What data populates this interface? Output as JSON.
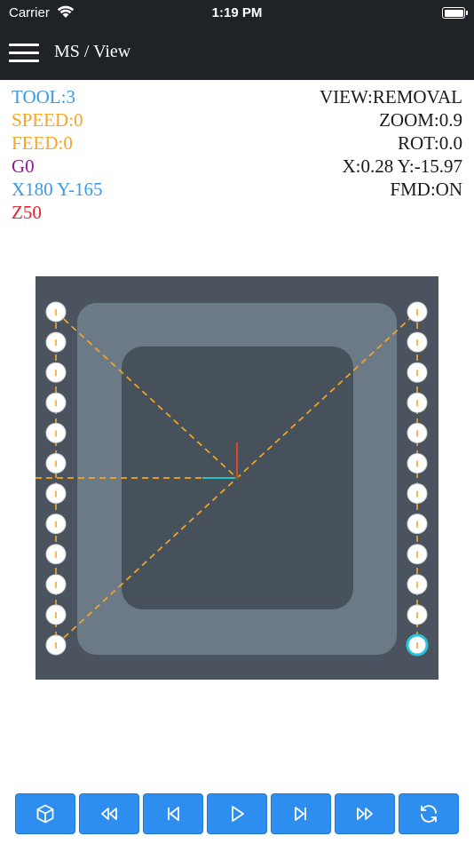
{
  "status_bar": {
    "carrier": "Carrier",
    "time": "1:19 PM"
  },
  "nav": {
    "title": "MS / View",
    "menu_icon": "hamburger-icon"
  },
  "info_left": {
    "tool": "TOOL:3",
    "speed": "SPEED:0",
    "feed": "FEED:0",
    "gcode": "G0",
    "xy": "X180 Y-165",
    "z": "Z50"
  },
  "info_right": {
    "view": "VIEW:REMOVAL",
    "zoom": "ZOOM:0.9",
    "rot": "ROT:0.0",
    "position": "X:0.28 Y:-15.97",
    "fmd": "FMD:ON"
  },
  "colors": {
    "tool": "#3a9ae8",
    "speed": "#f5a623",
    "feed": "#f5a623",
    "gcode": "#8b1a9b",
    "xy": "#3a9ae8",
    "z": "#e8232b",
    "canvas_bg": "#4b545e",
    "outer_pocket": "#6c7a88",
    "inner_pocket": "#47515b",
    "toolpath": "#f5a623",
    "button": "#2d8ef0"
  },
  "toolbar": [
    {
      "name": "view-3d-button",
      "icon": "cube-icon"
    },
    {
      "name": "rewind-button",
      "icon": "rewind-icon"
    },
    {
      "name": "step-back-button",
      "icon": "skip-back-icon"
    },
    {
      "name": "play-button",
      "icon": "play-icon"
    },
    {
      "name": "step-forward-button",
      "icon": "skip-forward-icon"
    },
    {
      "name": "fast-forward-button",
      "icon": "fast-forward-icon"
    },
    {
      "name": "refresh-button",
      "icon": "refresh-icon"
    }
  ]
}
